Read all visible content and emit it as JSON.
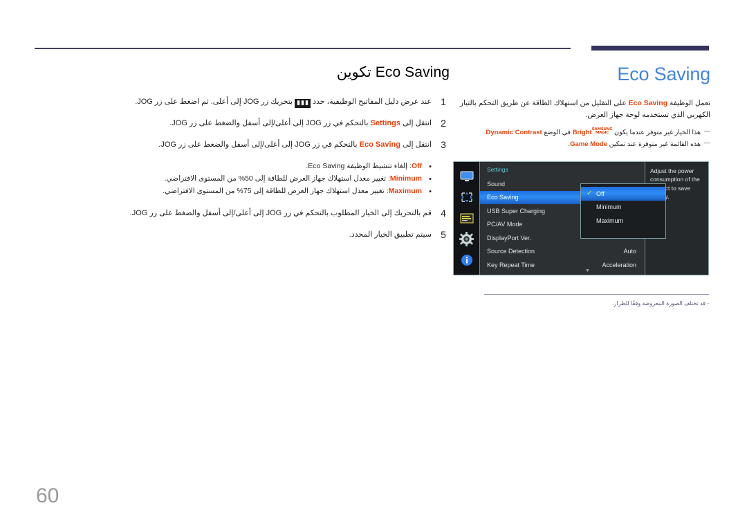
{
  "page": {
    "number": "60"
  },
  "left": {
    "title_ar": "تكوين",
    "title_en": "Eco Saving",
    "steps": [
      {
        "num": "1",
        "pre": "عند عرض دليل المفاتيح الوظيفية، حدد",
        "glyph": "▮▮▮",
        "post": "بتحريك زر JOG إلى أعلى. ثم اضغط على زر JOG."
      },
      {
        "num": "2",
        "pre": "انتقل إلى",
        "hl": "Settings",
        "post": "بالتحكم في زر JOG إلى أعلى/إلى أسفل والضغط على زر JOG."
      },
      {
        "num": "3",
        "pre": "انتقل إلى",
        "hl": "Eco Saving",
        "post": "بالتحكم في زر JOG إلى أعلى/إلى أسفل والضغط على زر JOG."
      }
    ],
    "options": [
      {
        "label": "Off",
        "text": ": إلغاء تنشيط الوظيفة Eco Saving."
      },
      {
        "label": "Minimum",
        "text": ": تغيير معدل استهلاك جهاز العرض للطاقة إلى 50% من المستوى الافتراضي."
      },
      {
        "label": "Maximum",
        "text": ": تغيير معدل استهلاك جهاز العرض للطاقة إلى 75% من المستوى الافتراضي."
      }
    ],
    "steps_tail": [
      {
        "num": "4",
        "text": "قم بالتحريك إلى الخيار المطلوب بالتحكم في زر JOG إلى أعلى/إلى أسفل والضغط على زر JOG."
      },
      {
        "num": "5",
        "text": "سيتم تطبيق الخيار المحدد."
      }
    ]
  },
  "right": {
    "heading": "Eco Saving",
    "body_pre": "تعمل الوظيفة",
    "body_hl": "Eco Saving",
    "body_post": "على التقليل من استهلاك الطاقة عن طريق التحكم بالتيار الكهربي الذي تستخدمه لوحة جهاز العرض.",
    "notes": [
      {
        "pre": "هذا الخيار غير متوفر عندما يكون",
        "magic_top": "SAMSUNG",
        "magic_bottom": "MAGIC",
        "magic_word": "Bright",
        "mid": "في الوضع",
        "hl": "Dynamic Contrast",
        "post": "."
      },
      {
        "pre": "هذه القائمة غير متوفرة عند تمكين",
        "hl": "Game Mode",
        "post": "."
      }
    ],
    "note_bottom": "- قد تختلف الصورة المعروضة وفقًا للطراز."
  },
  "osd": {
    "title": "Settings",
    "icons": [
      "display-icon",
      "picture-position-icon",
      "onscreen-display-icon",
      "system-gear-icon",
      "information-icon"
    ],
    "rows": [
      {
        "label": "Sound",
        "value": "",
        "selected": false
      },
      {
        "label": "Eco Saving",
        "value": "",
        "selected": true
      },
      {
        "label": "USB Super Charging",
        "value": "",
        "selected": false
      },
      {
        "label": "PC/AV Mode",
        "value": "",
        "selected": false
      },
      {
        "label": "DisplayPort Ver.",
        "value": "",
        "selected": false
      },
      {
        "label": "Source Detection",
        "value": "Auto",
        "selected": false
      },
      {
        "label": "Key Repeat Time",
        "value": "Acceleration",
        "selected": false
      }
    ],
    "submenu": [
      {
        "label": "Off",
        "checked": true,
        "selected": true
      },
      {
        "label": "Minimum",
        "checked": false,
        "selected": false
      },
      {
        "label": "Maximum",
        "checked": false,
        "selected": false
      }
    ],
    "description": "Adjust the power consumption of the product to save energy.",
    "scroll_arrow": "▼"
  },
  "colors": {
    "heading_blue": "#4484d8",
    "highlight_orange": "#e8430e",
    "osd_title_cyan": "#5ec8d6",
    "osd_select_blue": "#2f8df5",
    "rule_navy": "#33335c"
  }
}
